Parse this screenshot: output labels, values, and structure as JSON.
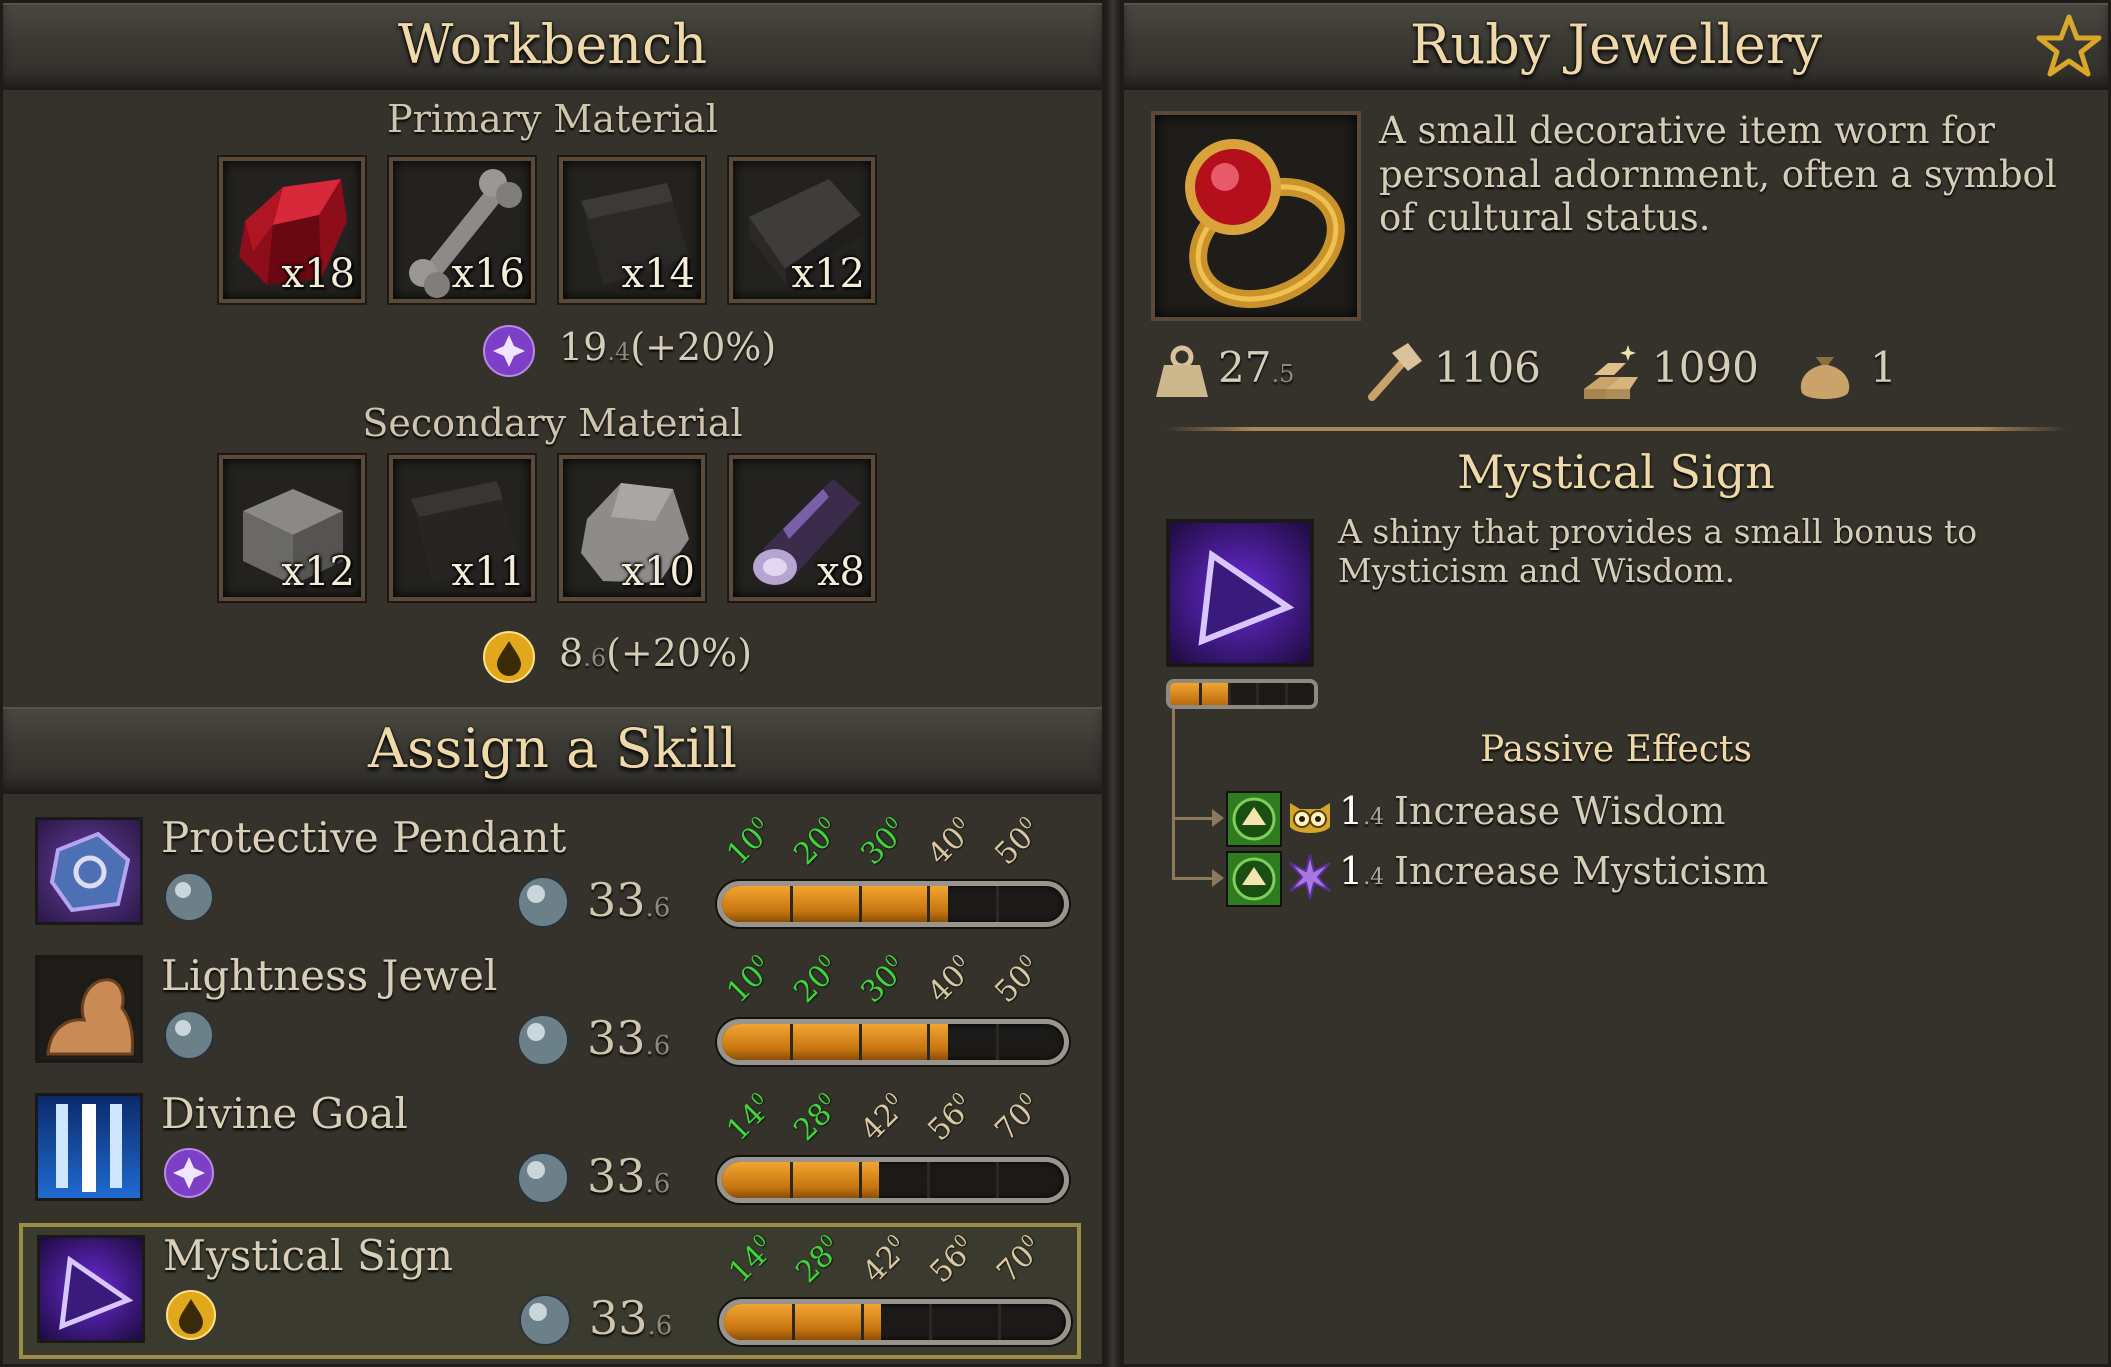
{
  "workbench": {
    "title": "Workbench",
    "primary_label": "Primary Material",
    "primary_items": [
      {
        "name": "ruby-ore",
        "count": "x18"
      },
      {
        "name": "bone",
        "count": "x16"
      },
      {
        "name": "dark-leather",
        "count": "x14"
      },
      {
        "name": "stone-slab",
        "count": "x12"
      }
    ],
    "primary_stat": {
      "icon": "mysticism-icon",
      "value": "19",
      "decimal": ".4",
      "bonus": "(+20%)"
    },
    "secondary_label": "Secondary Material",
    "secondary_items": [
      {
        "name": "stone-block",
        "count": "x12"
      },
      {
        "name": "dark-leather",
        "count": "x11"
      },
      {
        "name": "rock",
        "count": "x10"
      },
      {
        "name": "purple-crystal-log",
        "count": "x8"
      }
    ],
    "secondary_stat": {
      "icon": "wisdom-drop-icon",
      "value": "8",
      "decimal": ".6",
      "bonus": "(+20%)"
    }
  },
  "skills": {
    "title": "Assign a Skill",
    "rows": [
      {
        "name": "Protective Pendant",
        "cost": "33",
        "cost_decimal": ".6",
        "fill": 0.66,
        "thresholds": [
          [
            "10",
            "0",
            "green"
          ],
          [
            "20",
            "0",
            "green"
          ],
          [
            "30",
            "0",
            "green"
          ],
          [
            "40",
            "0",
            "tan"
          ],
          [
            "50",
            "0",
            "tan"
          ]
        ],
        "gem": "orb",
        "selected": false
      },
      {
        "name": "Lightness Jewel",
        "cost": "33",
        "cost_decimal": ".6",
        "fill": 0.66,
        "thresholds": [
          [
            "10",
            "0",
            "green"
          ],
          [
            "20",
            "0",
            "green"
          ],
          [
            "30",
            "0",
            "green"
          ],
          [
            "40",
            "0",
            "tan"
          ],
          [
            "50",
            "0",
            "tan"
          ]
        ],
        "gem": "orb",
        "selected": false
      },
      {
        "name": "Divine Goal",
        "cost": "33",
        "cost_decimal": ".6",
        "fill": 0.46,
        "thresholds": [
          [
            "14",
            "0",
            "green"
          ],
          [
            "28",
            "0",
            "green"
          ],
          [
            "42",
            "0",
            "tan"
          ],
          [
            "56",
            "0",
            "tan"
          ],
          [
            "70",
            "0",
            "tan"
          ]
        ],
        "gem": "mysticism",
        "selected": false
      },
      {
        "name": "Mystical Sign",
        "cost": "33",
        "cost_decimal": ".6",
        "fill": 0.46,
        "thresholds": [
          [
            "14",
            "0",
            "green"
          ],
          [
            "28",
            "0",
            "green"
          ],
          [
            "42",
            "0",
            "tan"
          ],
          [
            "56",
            "0",
            "tan"
          ],
          [
            "70",
            "0",
            "tan"
          ]
        ],
        "gem": "wisdom",
        "selected": true
      }
    ]
  },
  "item": {
    "title": "Ruby Jewellery",
    "description": "A small decorative item worn for personal adornment, often a symbol of cultural status.",
    "stats": {
      "weight": "27",
      "weight_decimal": ".5",
      "durability": "1106",
      "value": "1090",
      "quantity": "1"
    },
    "skill": {
      "title": "Mystical Sign",
      "description": "A shiny that provides a small bonus to Mysticism and Wisdom.",
      "level_fill": 0.42,
      "passive_label": "Passive Effects",
      "effects": [
        {
          "value": "1",
          "decimal": ".4",
          "text": "Increase Wisdom",
          "icon": "owl-icon"
        },
        {
          "value": "1",
          "decimal": ".4",
          "text": "Increase Mysticism",
          "icon": "mysticism-star-icon"
        }
      ]
    }
  },
  "colors": {
    "accent_gold": "#f0d9a8",
    "bar_orange": "#e8921f",
    "green_threshold": "#3fd43a"
  }
}
